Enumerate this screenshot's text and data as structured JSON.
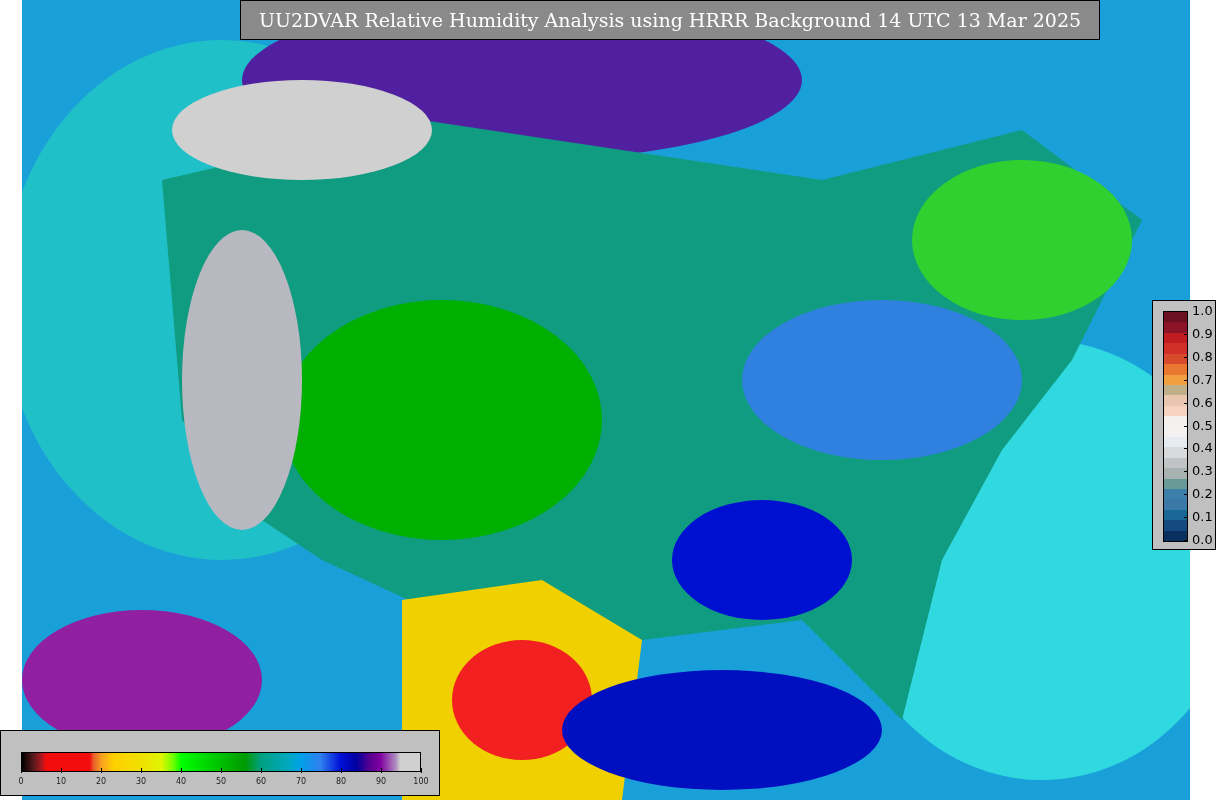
{
  "title": "UU2DVAR Relative Humidity Analysis using HRRR Background 14 UTC 13 Mar 2025",
  "humidity_colorbar": {
    "ticks": [
      "0",
      "10",
      "20",
      "30",
      "40",
      "50",
      "60",
      "70",
      "80",
      "90",
      "100"
    ]
  },
  "weight_colorbar": {
    "ticks": [
      "1.0",
      "0.9",
      "0.8",
      "0.7",
      "0.6",
      "0.5",
      "0.4",
      "0.3",
      "0.2",
      "0.1",
      "0.0"
    ]
  }
}
